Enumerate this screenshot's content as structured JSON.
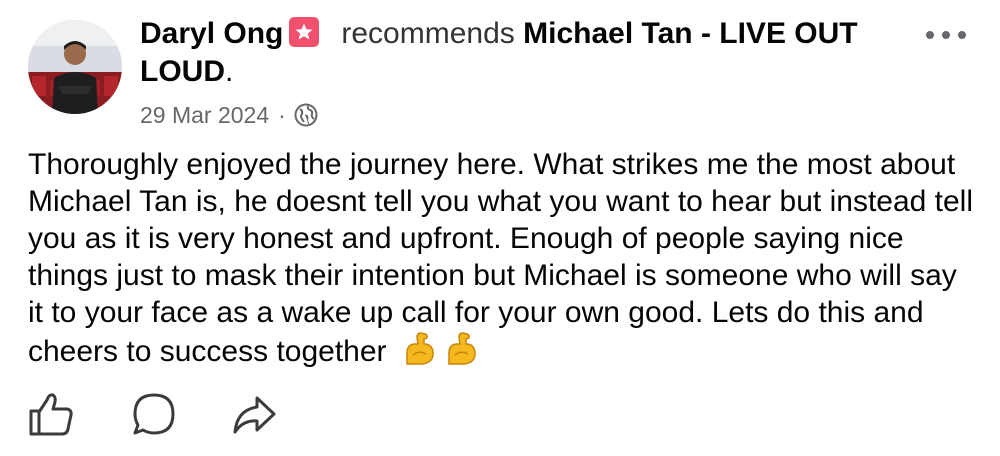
{
  "post": {
    "author_name": "Daryl Ong",
    "action_text": "recommends",
    "target_name": "Michael Tan - LIVE OUT LOUD",
    "target_suffix": ".",
    "date": "29 Mar 2024",
    "separator": "·",
    "audience_icon": "globe-icon",
    "recommend_badge_icon": "star-icon",
    "text": "Thoroughly enjoyed the journey here. What strikes me the most about Michael Tan is, he doesnt tell you what you want to hear but instead tell you as it is very honest and upfront. Enough of people saying nice things just to mask their intention but Michael is someone who will say it to your face as a wake up call for your own good. Lets do this and cheers to success together",
    "emoji": [
      "flexed-biceps-icon",
      "flexed-biceps-icon"
    ]
  },
  "actions": {
    "like_icon": "thumbs-up-icon",
    "comment_icon": "comment-icon",
    "share_icon": "share-arrow-icon"
  },
  "colors": {
    "badge": "#f0506e",
    "meta_text": "#65676b",
    "body_text": "#050505"
  }
}
